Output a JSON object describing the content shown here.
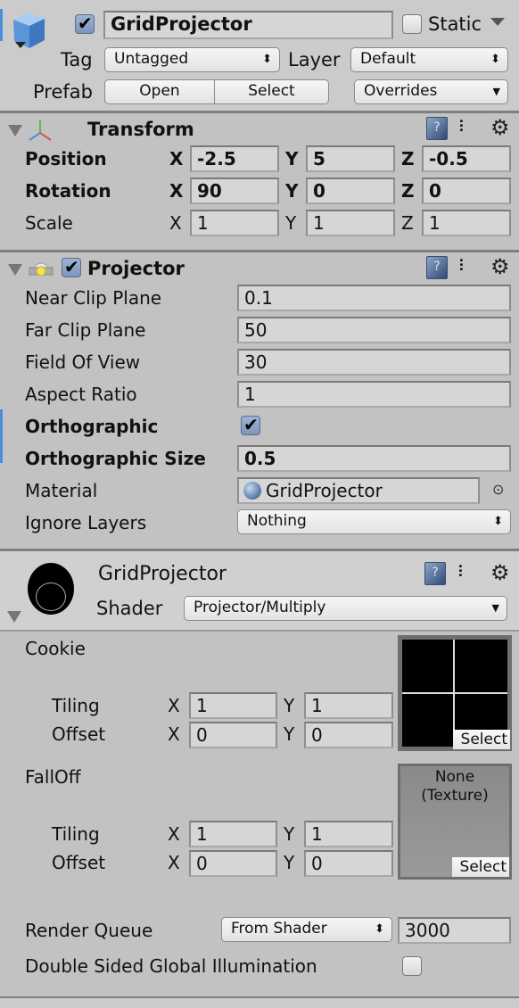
{
  "header": {
    "object_name": "GridProjector",
    "active": true,
    "static_label": "Static",
    "static_checked": false,
    "tag_label": "Tag",
    "tag_value": "Untagged",
    "layer_label": "Layer",
    "layer_value": "Default",
    "prefab_label": "Prefab",
    "prefab_open": "Open",
    "prefab_select": "Select",
    "overrides": "Overrides"
  },
  "transform": {
    "title": "Transform",
    "rows": [
      {
        "label": "Position",
        "x": "-2.5",
        "y": "5",
        "z": "-0.5"
      },
      {
        "label": "Rotation",
        "x": "90",
        "y": "0",
        "z": "0"
      },
      {
        "label": "Scale",
        "x": "1",
        "y": "1",
        "z": "1"
      }
    ],
    "axis": {
      "x": "X",
      "y": "Y",
      "z": "Z"
    }
  },
  "projector": {
    "title": "Projector",
    "enabled": true,
    "near_clip_label": "Near Clip Plane",
    "near_clip": "0.1",
    "far_clip_label": "Far Clip Plane",
    "far_clip": "50",
    "fov_label": "Field Of View",
    "fov": "30",
    "aspect_label": "Aspect Ratio",
    "aspect": "1",
    "ortho_label": "Orthographic",
    "ortho": true,
    "ortho_size_label": "Orthographic Size",
    "ortho_size": "0.5",
    "material_label": "Material",
    "material": "GridProjector",
    "ignore_layers_label": "Ignore Layers",
    "ignore_layers": "Nothing"
  },
  "material": {
    "name": "GridProjector",
    "shader_label": "Shader",
    "shader": "Projector/Multiply",
    "cookie_label": "Cookie",
    "cookie_tiling_label": "Tiling",
    "cookie_tiling_x": "1",
    "cookie_tiling_y": "1",
    "cookie_offset_label": "Offset",
    "cookie_offset_x": "0",
    "cookie_offset_y": "0",
    "cookie_select": "Select",
    "falloff_label": "FallOff",
    "falloff_tiling_label": "Tiling",
    "falloff_tiling_x": "1",
    "falloff_tiling_y": "1",
    "falloff_offset_label": "Offset",
    "falloff_offset_x": "0",
    "falloff_offset_y": "0",
    "falloff_none_line1": "None",
    "falloff_none_line2": "(Texture)",
    "falloff_select": "Select",
    "render_queue_label": "Render Queue",
    "render_queue_mode": "From Shader",
    "render_queue_value": "3000",
    "dsgi_label": "Double Sided Global Illumination",
    "dsgi_checked": false
  },
  "icons": {
    "help": "?",
    "preset": "⫶",
    "gear": "⚙",
    "updown": "⬍",
    "down": "▼",
    "target": "⊙"
  }
}
